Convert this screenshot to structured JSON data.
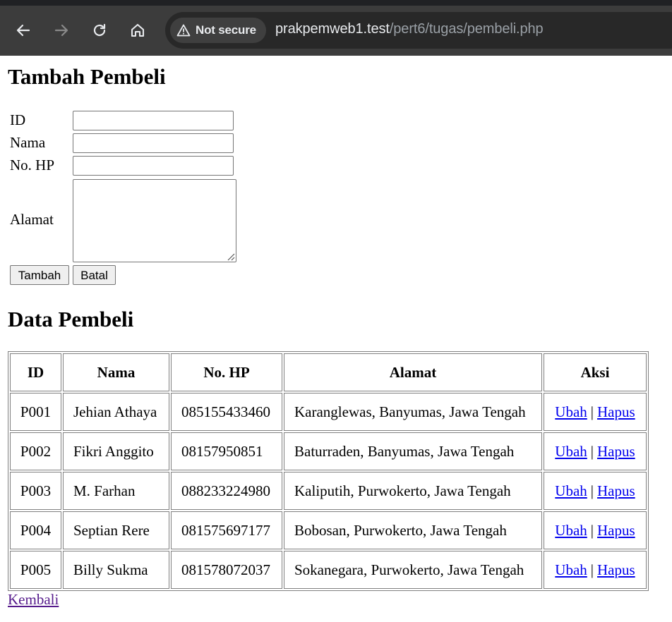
{
  "browser": {
    "security_label": "Not secure",
    "url_host": "prakpemweb1.test",
    "url_path": "/pert6/tugas/pembeli.php",
    "icons": [
      "back-icon",
      "forward-icon",
      "reload-icon",
      "home-icon",
      "warning-icon"
    ]
  },
  "form": {
    "title": "Tambah Pembeli",
    "fields": [
      {
        "label": "ID",
        "value": ""
      },
      {
        "label": "Nama",
        "value": ""
      },
      {
        "label": "No. HP",
        "value": ""
      },
      {
        "label": "Alamat",
        "value": ""
      }
    ],
    "submit_label": "Tambah",
    "cancel_label": "Batal"
  },
  "table": {
    "title": "Data Pembeli",
    "headers": [
      "ID",
      "Nama",
      "No. HP",
      "Alamat",
      "Aksi"
    ],
    "rows": [
      {
        "id": "P001",
        "nama": "Jehian Athaya",
        "hp": "085155433460",
        "alamat": "Karanglewas, Banyumas, Jawa Tengah",
        "edit": "Ubah",
        "delete": "Hapus"
      },
      {
        "id": "P002",
        "nama": "Fikri Anggito",
        "hp": "08157950851",
        "alamat": "Baturraden, Banyumas, Jawa Tengah",
        "edit": "Ubah",
        "delete": "Hapus"
      },
      {
        "id": "P003",
        "nama": "M. Farhan",
        "hp": "088233224980",
        "alamat": "Kaliputih, Purwokerto, Jawa Tengah",
        "edit": "Ubah",
        "delete": "Hapus"
      },
      {
        "id": "P004",
        "nama": "Septian Rere",
        "hp": "081575697177",
        "alamat": "Bobosan, Purwokerto, Jawa Tengah",
        "edit": "Ubah",
        "delete": "Hapus"
      },
      {
        "id": "P005",
        "nama": "Billy Sukma",
        "hp": "081578072037",
        "alamat": "Sokanegara, Purwokerto, Jawa Tengah",
        "edit": "Ubah",
        "delete": "Hapus"
      }
    ],
    "action_separator": "|"
  },
  "back_link": "Kembali",
  "colors": {
    "chrome_bg": "#3c3c3c",
    "omnibox_bg": "#282828",
    "link": "#0000ee",
    "visited_link": "#551a8b"
  }
}
